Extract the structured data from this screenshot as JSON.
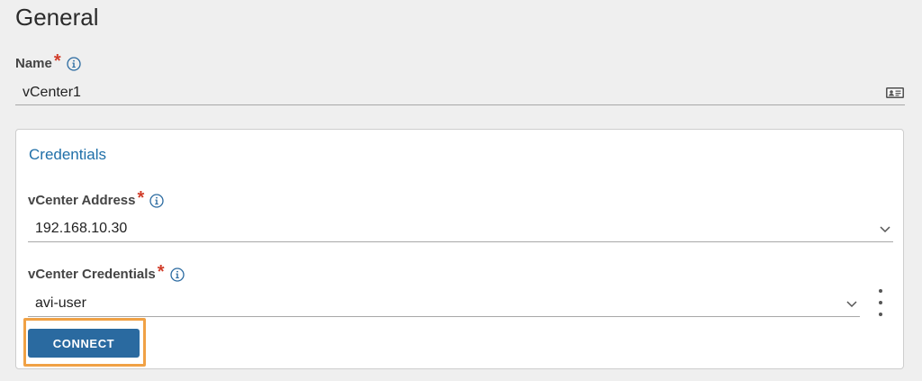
{
  "section": {
    "title": "General"
  },
  "name": {
    "label": "Name",
    "required": "*",
    "value": "vCenter1",
    "icon": "id-card-icon"
  },
  "credentials_panel": {
    "title": "Credentials",
    "address": {
      "label": "vCenter Address",
      "required": "*",
      "value": "192.168.10.30"
    },
    "credentials": {
      "label": "vCenter Credentials",
      "required": "*",
      "value": "avi-user"
    },
    "connect_label": "CONNECT"
  },
  "colors": {
    "accent": "#2a6aa0",
    "link": "#1f6fa8",
    "required": "#d13d2a",
    "highlight": "#f0a145"
  }
}
